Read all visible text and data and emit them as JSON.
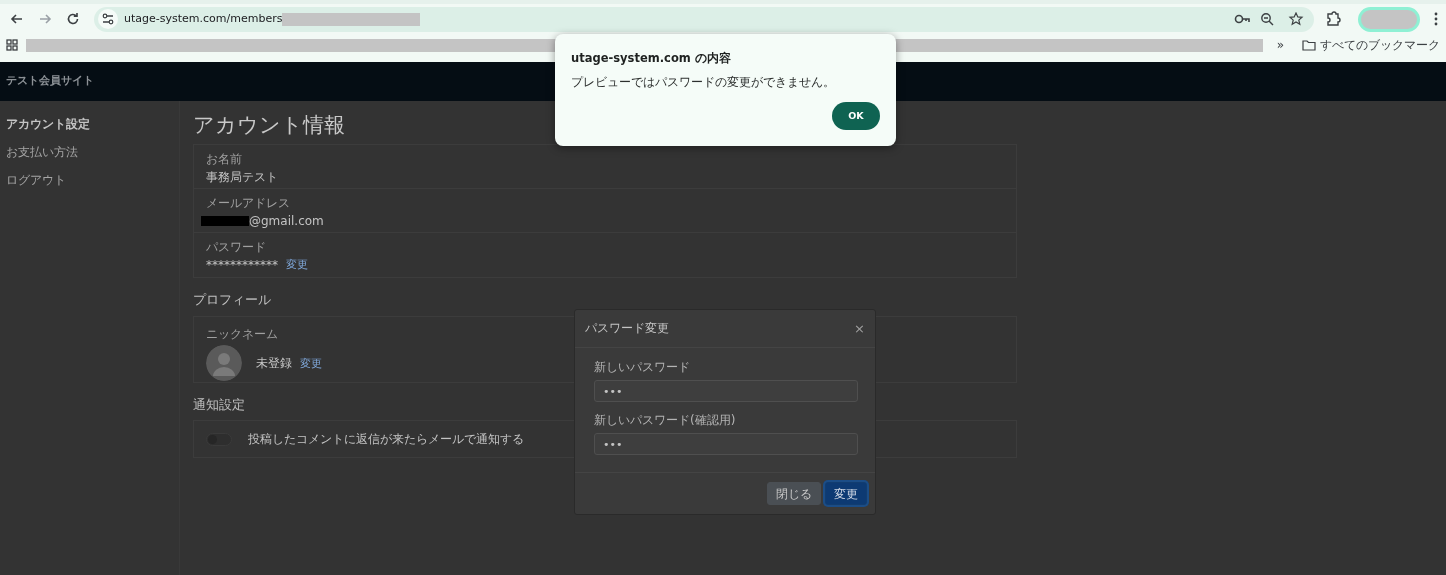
{
  "browser": {
    "url": "utage-system.com/members",
    "overflow": "»",
    "bookmarks_folder": "すべてのブックマーク"
  },
  "site": {
    "title": "テスト会員サイト"
  },
  "sidebar": {
    "items": [
      {
        "label": "アカウント設定",
        "selected": true
      },
      {
        "label": "お支払い方法",
        "selected": false
      },
      {
        "label": "ログアウト",
        "selected": false
      }
    ]
  },
  "account": {
    "heading": "アカウント情報",
    "fields": [
      {
        "label": "お名前",
        "value": "事務局テスト"
      },
      {
        "label": "メールアドレス",
        "value": "@gmail.com",
        "redacted": true
      },
      {
        "label": "パスワード",
        "value": "************",
        "link": "変更"
      }
    ]
  },
  "profile": {
    "heading": "プロフィール",
    "label": "ニックネーム",
    "value": "未登録",
    "link": "変更"
  },
  "notifications": {
    "heading": "通知設定",
    "items": [
      {
        "label": "投稿したコメントに返信が来たらメールで通知する",
        "on": false
      }
    ]
  },
  "modal": {
    "title": "パスワード変更",
    "close": "×",
    "fields": [
      {
        "label": "新しいパスワード",
        "value": "•••"
      },
      {
        "label": "新しいパスワード(確認用)",
        "value": "•••"
      }
    ],
    "buttons": [
      {
        "label": "閉じる",
        "kind": "secondary"
      },
      {
        "label": "変更",
        "kind": "primary"
      }
    ]
  },
  "alert": {
    "title": "utage-system.com の内容",
    "message": "プレビューではパスワードの変更ができません。",
    "button": "OK"
  }
}
